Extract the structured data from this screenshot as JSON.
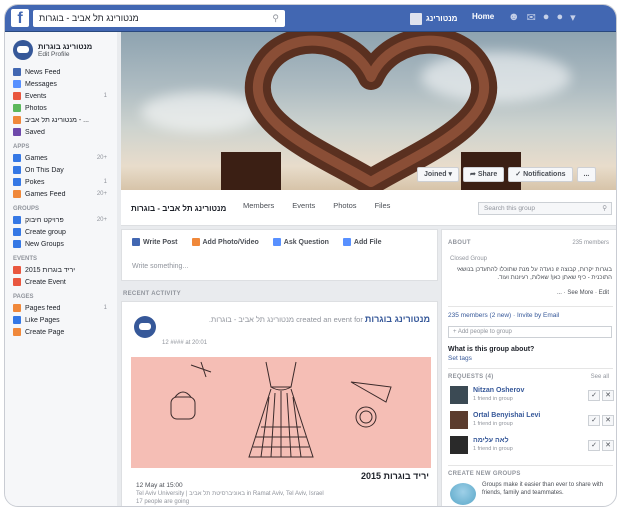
{
  "topbar": {
    "search_value": "מנטורינג תל אביב - בוגרות",
    "user_name": "מנטורינג",
    "home_label": "Home"
  },
  "sidebar": {
    "profile": {
      "name": "מנטורינג בוגרות",
      "edit_label": "Edit Profile"
    },
    "items": [
      {
        "label": "News Feed",
        "count": "",
        "color": "#4267b2",
        "icon": "news-feed-icon"
      },
      {
        "label": "Messages",
        "count": "",
        "color": "#5890ff",
        "icon": "messages-icon"
      },
      {
        "label": "Events",
        "count": "1",
        "color": "#e9573f",
        "icon": "events-icon"
      },
      {
        "label": "Photos",
        "count": "",
        "color": "#5cb85c",
        "icon": "photos-icon"
      },
      {
        "label": "מנטורינג תל אביב - ...",
        "count": "",
        "color": "#f0883a",
        "icon": "group-icon"
      },
      {
        "label": "Saved",
        "count": "",
        "color": "#6e48aa",
        "icon": "saved-icon"
      }
    ],
    "apps_head": "APPS",
    "apps": [
      {
        "label": "Games",
        "count": "20+",
        "color": "#3578e5",
        "icon": "games-icon"
      },
      {
        "label": "On This Day",
        "count": "",
        "color": "#3578e5",
        "icon": "on-this-day-icon"
      },
      {
        "label": "Pokes",
        "count": "1",
        "color": "#3578e5",
        "icon": "pokes-icon"
      },
      {
        "label": "Games Feed",
        "count": "20+",
        "color": "#f0883a",
        "icon": "games-feed-icon"
      }
    ],
    "groups_head": "GROUPS",
    "groups": [
      {
        "label": "פרויקט חיבוק",
        "count": "20+",
        "color": "#3578e5",
        "icon": "group-icon"
      },
      {
        "label": "Create group",
        "count": "",
        "color": "#3578e5",
        "icon": "create-group-icon"
      },
      {
        "label": "New Groups",
        "count": "",
        "color": "#3578e5",
        "icon": "new-groups-icon"
      }
    ],
    "events_head": "EVENTS",
    "events": [
      {
        "label": "יריד בוגרות 2015",
        "count": "",
        "color": "#e9573f",
        "icon": "event-icon"
      },
      {
        "label": "Create Event",
        "count": "",
        "color": "#e9573f",
        "icon": "create-event-icon"
      }
    ],
    "pages_head": "PAGES",
    "pages": [
      {
        "label": "Pages feed",
        "count": "1",
        "color": "#f0883a",
        "icon": "pages-feed-icon"
      },
      {
        "label": "Like Pages",
        "count": "",
        "color": "#3578e5",
        "icon": "like-pages-icon"
      },
      {
        "label": "Create Page",
        "count": "",
        "color": "#f0883a",
        "icon": "create-page-icon"
      }
    ]
  },
  "cover": {
    "joined": "Joined ▾",
    "share": "➦ Share",
    "notifications": "✓ Notifications",
    "more": "..."
  },
  "group_nav": {
    "name": "מנטורינג תל אביב - בוגרות",
    "tabs": [
      "Members",
      "Events",
      "Photos",
      "Files"
    ],
    "search_placeholder": "Search this group"
  },
  "composer": {
    "tabs": [
      {
        "label": "Write Post",
        "color": "#4267b2"
      },
      {
        "label": "Add Photo/Video",
        "color": "#f0883a"
      },
      {
        "label": "Ask Question",
        "color": "#5890ff"
      },
      {
        "label": "Add File",
        "color": "#5890ff"
      }
    ],
    "placeholder": "Write something..."
  },
  "recent_label": "RECENT ACTIVITY",
  "post": {
    "author": "מנטורינג בוגרות",
    "action": "created an event for מנטורינג תל אביב - בוגרות.",
    "time": "12 #### at 20:01",
    "event_title": "יריד בוגרות 2015",
    "event_date": "12 May at 15:00",
    "event_location": "Tel Aviv University | באוניברסיטת תל אביב in Ramat Aviv, Tel Aviv, Israel",
    "event_going": "17 people are going"
  },
  "about": {
    "head": "ABOUT",
    "members": "235 members",
    "closed": "Closed Group",
    "description": "בוגרות יקרות, קבוצה זו נועדה על מנת שתוכלו להתעדכן בנושאי התוכנית - כיף שאתן כאן! שאלות, רעיונות ועוד.",
    "see_more": "See More · Edit · ...",
    "members_line": "235 members (2 new) · Invite by Email",
    "add_people": "+ Add people to group",
    "what_is": "What is this group about?",
    "set_tags": "Set tags",
    "requests_head": "REQUESTS (4)",
    "see_all": "See all",
    "requests": [
      {
        "name": "Nitzan Osherov",
        "friends": "1 friend in group"
      },
      {
        "name": "Ortal Benyishai Levi",
        "friends": "1 friend in group"
      },
      {
        "name": "לאה עלימה",
        "friends": "1 friend in group"
      }
    ],
    "create_head": "CREATE NEW GROUPS",
    "create_text": "Groups make it easier than ever to share with friends, family and teammates."
  }
}
